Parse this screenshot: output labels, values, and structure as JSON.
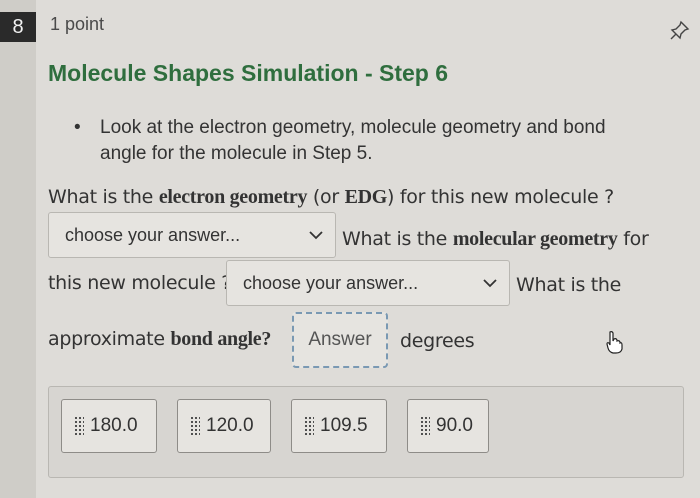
{
  "question": {
    "number": "8",
    "points": "1 point",
    "title": "Molecule Shapes Simulation - Step 6",
    "bullet": "Look at the electron geometry, molecule geometry and bond angle for the molecule in Step 5."
  },
  "prompt": {
    "q1_pre": "What is the ",
    "q1_bold": "electron geometry",
    "q1_mid": " (or ",
    "q1_bold2": "EDG",
    "q1_post": ") for this new molecule ?",
    "q2_pre": "What is the ",
    "q2_bold": "molecular geometry",
    "q2_post": " for",
    "q2_line2": "this new molecule ?",
    "q3_pre": "What is the",
    "q3_line2_pre": "approximate ",
    "q3_bold": "bond angle?",
    "q3_units": "degrees"
  },
  "dropdowns": {
    "electron_geometry": "choose your answer...",
    "molecular_geometry": "choose your answer..."
  },
  "answer_box": {
    "placeholder": "Answer"
  },
  "choices": [
    "180.0",
    "120.0",
    "109.5",
    "90.0"
  ],
  "icons": {
    "pin": "pin-icon",
    "chevron": "chevron-down-icon",
    "grip": "drag-handle-icon",
    "cursor": "hand-cursor-icon"
  },
  "colors": {
    "title": "#2f6e3e",
    "question_badge": "#2a2a2a",
    "drop_zone_border": "#7a99b3"
  }
}
